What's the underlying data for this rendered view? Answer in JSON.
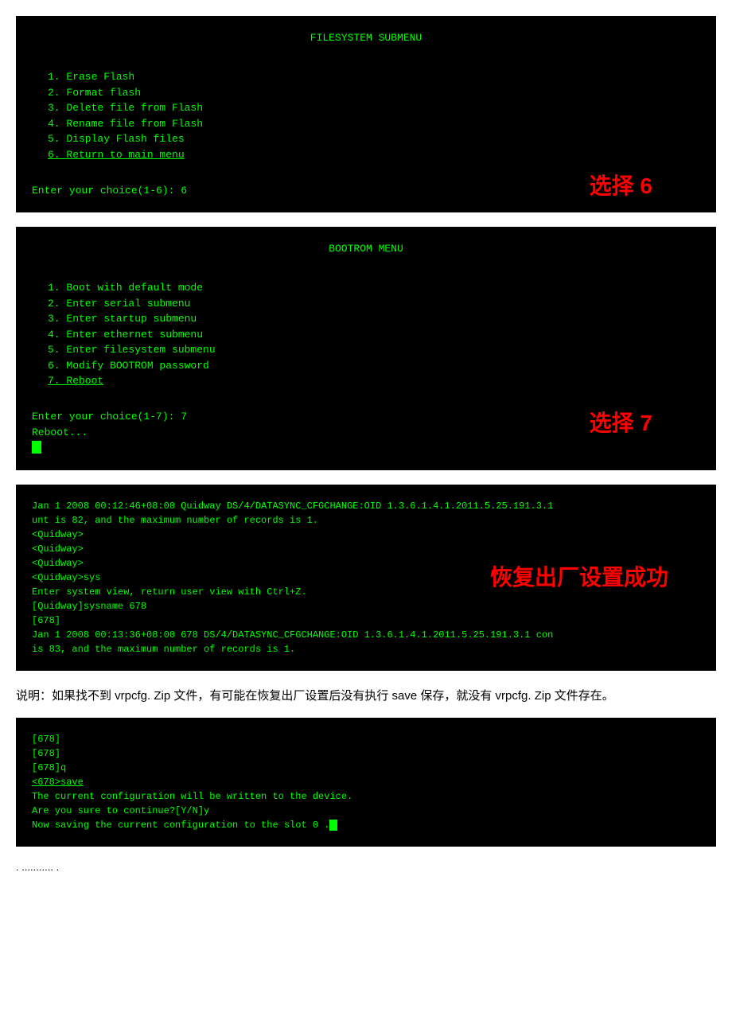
{
  "block1": {
    "title": "FILESYSTEM SUBMENU",
    "items": [
      "1. Erase Flash",
      "2. Format flash",
      "3. Delete file from Flash",
      "4. Rename file from Flash",
      "5. Display Flash files",
      "6. Return to main menu"
    ],
    "prompt": "Enter your choice(1-6): 6",
    "choice_label": "选择 6"
  },
  "block2": {
    "title": "BOOTROM  MENU",
    "items": [
      "1. Boot with default mode",
      "2. Enter serial submenu",
      "3. Enter startup submenu",
      "4. Enter ethernet submenu",
      "5. Enter filesystem submenu",
      "6. Modify BOOTROM password",
      "7. Reboot"
    ],
    "prompt": "Enter your choice(1-7): 7",
    "reboot": "Reboot...",
    "choice_label": "选择 7"
  },
  "block3": {
    "lines": [
      "Jan  1 2008 00:12:46+08:00 Quidway DS/4/DATASYNC_CFGCHANGE:OID 1.3.6.1.4.1.2011.5.25.191.3.1",
      "unt is 82, and the maximum number of records is 1.",
      "<Quidway>",
      "<Quidway>",
      "<Quidway>",
      "<Quidway>sys",
      "Enter system view, return user view with Ctrl+Z.",
      "[Quidway]sysname 678",
      "[678]",
      "Jan  1 2008 00:13:36+08:00 678 DS/4/DATASYNC_CFGCHANGE:OID 1.3.6.1.4.1.2011.5.25.191.3.1 con",
      "is 83, and the maximum number of records is 1."
    ],
    "factory_label": "恢复出厂设置成功"
  },
  "note": {
    "text": "说明：如果找不到 vrpcfg. Zip 文件，有可能在恢复出厂设置后没有执行 save 保存，就没有 vrpcfg. Zip 文件存在。"
  },
  "block4": {
    "lines": [
      "[678]",
      "[678]",
      "[678]q",
      "<678>save",
      "The current configuration will be written to the device.",
      "Are you sure to continue?[Y/N]y",
      "Now saving the current configuration to the slot 0 ."
    ]
  },
  "footer": {
    "text": ". ........... ."
  }
}
